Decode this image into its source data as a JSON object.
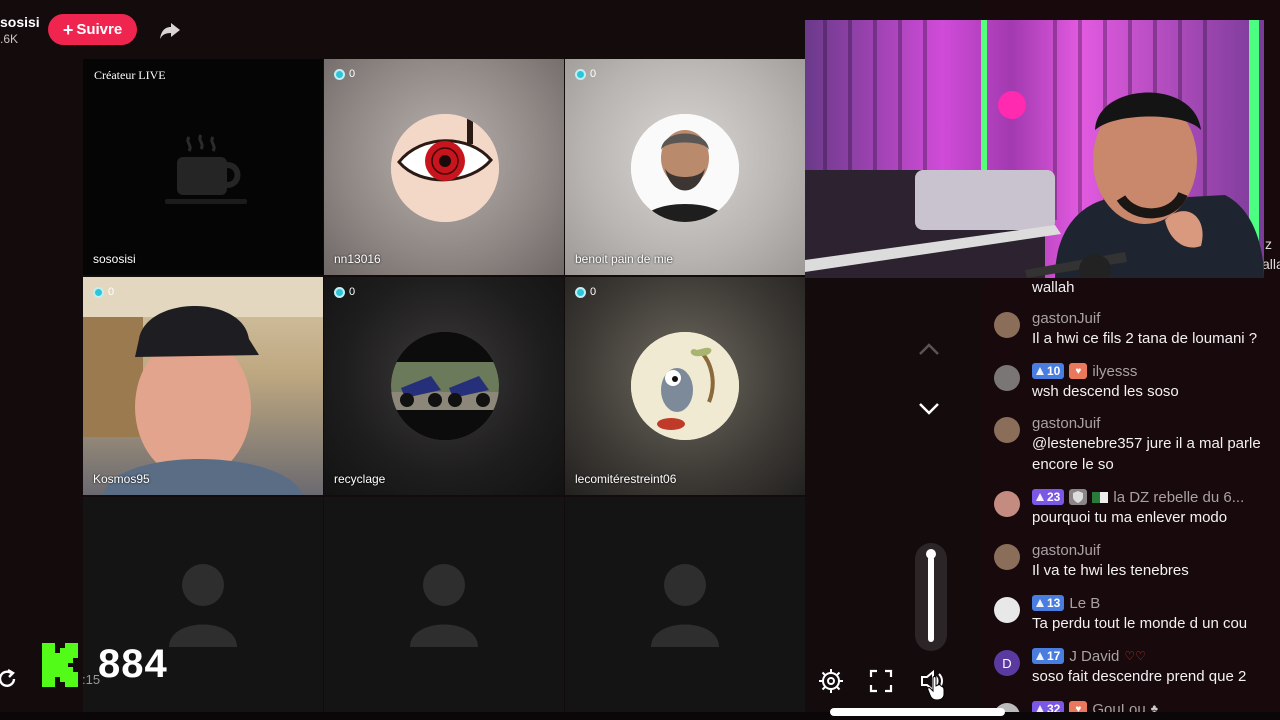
{
  "header": {
    "host_name": "sosisi",
    "host_likes": ".6K",
    "follow_label": "Suivre",
    "follow_plus": "+"
  },
  "grid": {
    "creator_tag": "Créateur LIVE",
    "tiles": [
      {
        "name": "sososisi",
        "badge": null
      },
      {
        "name": "nn13016",
        "badge": "0"
      },
      {
        "name": "benoit pain de mie",
        "badge": "0"
      },
      {
        "name": "Kosmos95",
        "badge": "0"
      },
      {
        "name": "recyclage",
        "badge": "0"
      },
      {
        "name": "lecomitérestreint06",
        "badge": "0"
      }
    ]
  },
  "overlay": {
    "viewer_count": "884",
    "timer_fragment": ":15"
  },
  "chat": {
    "partial_right_1": "z",
    "partial_right_2": "alla",
    "messages": [
      {
        "user": "",
        "text": "wallah"
      },
      {
        "user": "gastonJuif",
        "text": "Il a hwi ce fils 2 tana de loumani ?"
      },
      {
        "user": "ilyesss",
        "level": "10",
        "text": "wsh descend les soso"
      },
      {
        "user": "gastonJuif",
        "text": "@lestenebre357 jure il a mal parle",
        "text2": "encore le so"
      },
      {
        "user": "la DZ rebelle du 6...",
        "level": "23",
        "text": "pourquoi tu ma enlever modo"
      },
      {
        "user": "gastonJuif",
        "text": "Il va te hwi les tenebres"
      },
      {
        "user": "Le B",
        "level": "13",
        "text": "Ta perdu tout le monde d un cou"
      },
      {
        "user": "J David",
        "level": "17",
        "avatar_letter": "D",
        "text": "soso fait descendre prend que 2"
      },
      {
        "user": "GouLou",
        "level": "32",
        "text": ""
      }
    ]
  },
  "colors": {
    "follow": "#f0254f",
    "kick_green": "#53fc18",
    "level_blue": "#4a7de0",
    "level_purple": "#7b57e6"
  }
}
